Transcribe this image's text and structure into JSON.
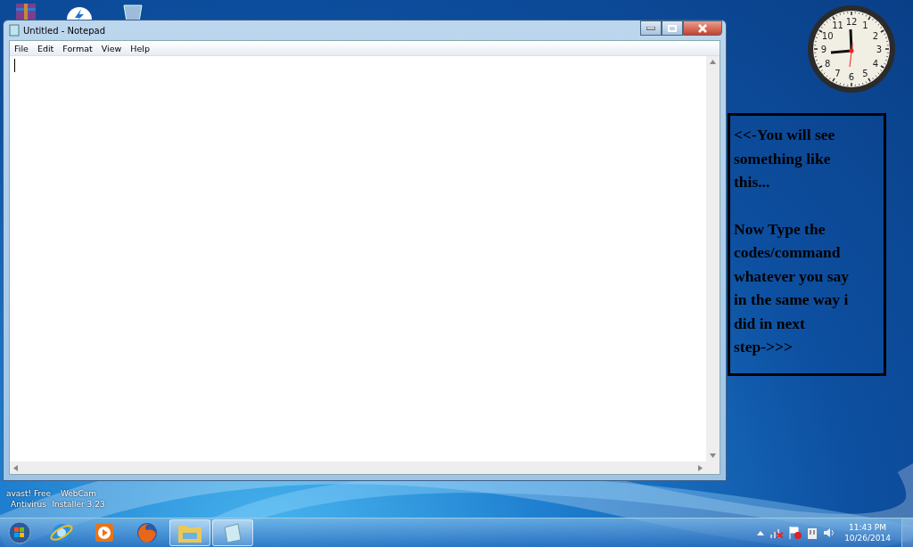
{
  "desktop_icons": [
    {
      "kind": "archive"
    },
    {
      "kind": "updater"
    },
    {
      "kind": "bin"
    }
  ],
  "desktop_labels": [
    {
      "label": "avast! Free Antivirus"
    },
    {
      "label": "WebCam Installer 3.23"
    }
  ],
  "window": {
    "title": "Untitled - Notepad",
    "menu": [
      "File",
      "Edit",
      "Format",
      "View",
      "Help"
    ]
  },
  "clock": {
    "numerals": [
      "12",
      "11",
      "1",
      "10",
      "2",
      "9",
      "3",
      "8",
      "4",
      "7",
      "5",
      "6"
    ]
  },
  "note": {
    "paragraphs": [
      [
        "<<-You will see",
        "something like",
        "this..."
      ],
      [
        "Now Type the",
        "codes/command",
        "whatever you say",
        "in the same way i",
        "did in next",
        "step->>>"
      ]
    ]
  },
  "taskbar": {
    "apps": [
      {
        "kind": "ie",
        "selected": false
      },
      {
        "kind": "media",
        "selected": false
      },
      {
        "kind": "firefox",
        "selected": false
      },
      {
        "kind": "folder",
        "selected": true
      },
      {
        "kind": "notepad",
        "selected": true
      }
    ],
    "time": "11:43 PM",
    "date": "10/26/2014"
  }
}
